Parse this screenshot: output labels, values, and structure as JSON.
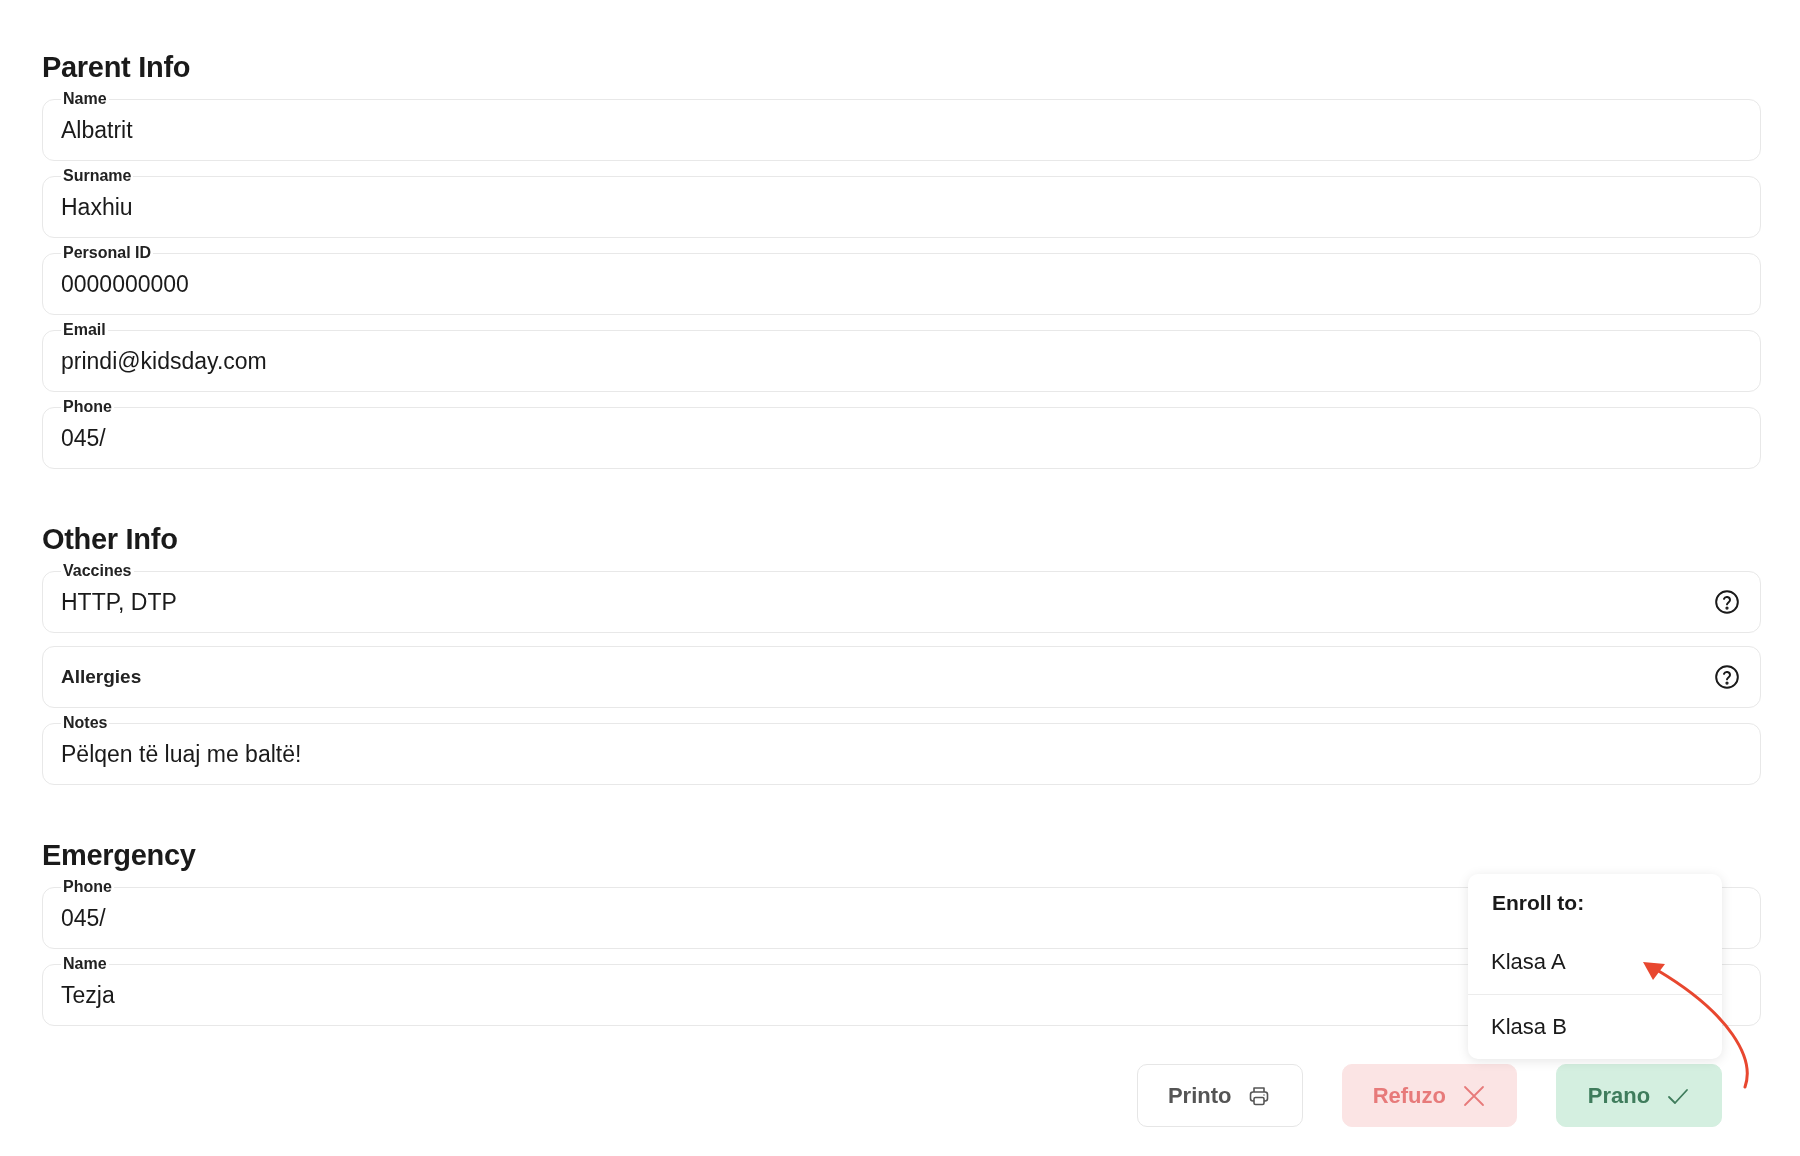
{
  "sections": [
    {
      "title": "Parent Info",
      "fields": [
        {
          "label": "Name",
          "value": "Albatrit",
          "help": false
        },
        {
          "label": "Surname",
          "value": "Haxhiu",
          "help": false
        },
        {
          "label": "Personal ID",
          "value": "0000000000",
          "help": false
        },
        {
          "label": "Email",
          "value": "prindi@kidsday.com",
          "help": false
        },
        {
          "label": "Phone",
          "value": "045/",
          "help": false
        }
      ]
    },
    {
      "title": "Other Info",
      "fields": [
        {
          "label": "Vaccines",
          "value": "HTTP, DTP",
          "help": true
        },
        {
          "label": "Allergies",
          "help": true
        },
        {
          "label": "Notes",
          "value": "Pëlqen të luaj me baltë!",
          "help": false
        }
      ]
    },
    {
      "title": "Emergency",
      "fields": [
        {
          "label": "Phone",
          "value": "045/",
          "help": false
        },
        {
          "label": "Name",
          "value": "Tezja",
          "help": false
        }
      ]
    }
  ],
  "enroll_menu": {
    "title": "Enroll to:",
    "options": [
      "Klasa A",
      "Klasa B"
    ]
  },
  "buttons": [
    {
      "label": "Printo",
      "kind": "print"
    },
    {
      "label": "Refuzo",
      "kind": "reject"
    },
    {
      "label": "Prano",
      "kind": "accept"
    }
  ]
}
